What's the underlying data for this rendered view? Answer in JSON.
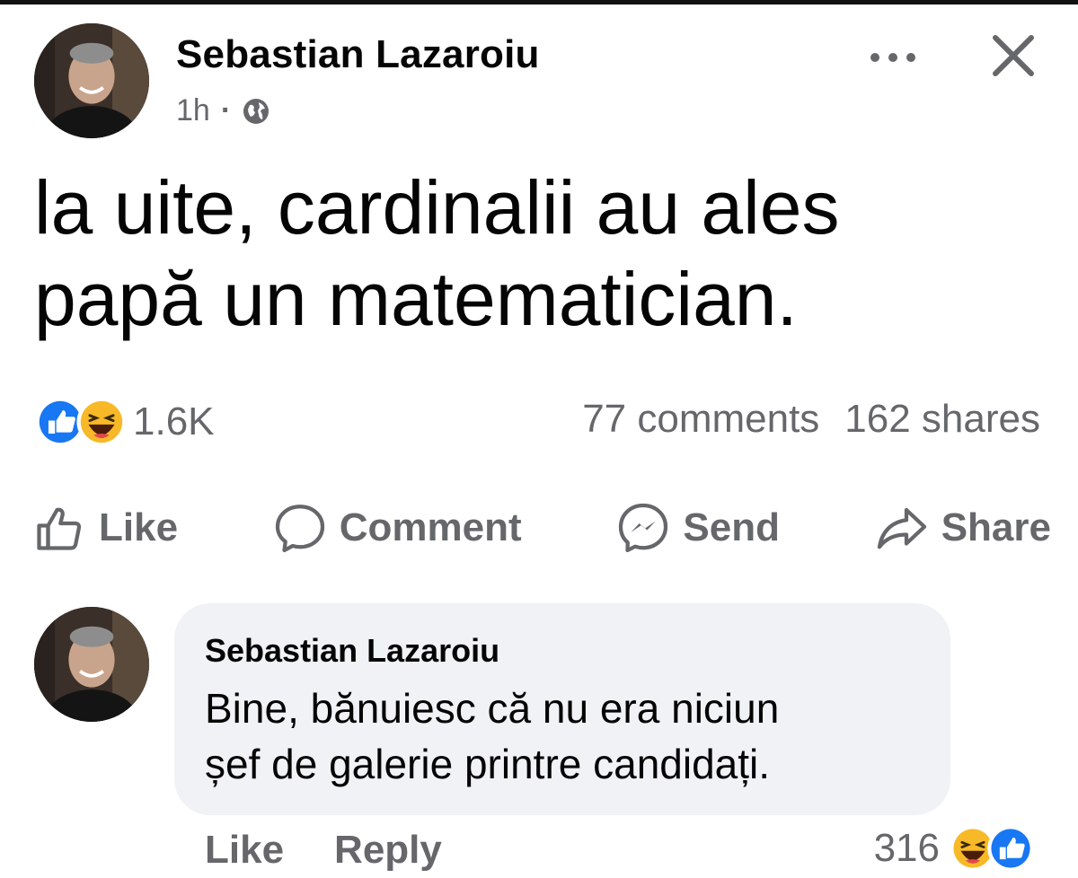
{
  "post": {
    "author": "Sebastian Lazaroiu",
    "time": "1h",
    "separator": "·",
    "privacy_icon": "globe-icon",
    "text_line1": "la uite, cardinalii au ales",
    "text_line2": "papă un matematician.",
    "reactions": {
      "icons": [
        "like-icon",
        "haha-icon"
      ],
      "count": "1.6K"
    },
    "comments": "77 comments",
    "shares": "162 shares",
    "actions": {
      "like": "Like",
      "comment": "Comment",
      "send": "Send",
      "share": "Share"
    }
  },
  "comment": {
    "author": "Sebastian Lazaroiu",
    "text_line1": "Bine, bănuiesc că nu era niciun",
    "text_line2": "șef de galerie printre candidați.",
    "like": "Like",
    "reply": "Reply",
    "reaction_count": "316",
    "reaction_icons": [
      "haha-icon",
      "like-icon"
    ]
  },
  "colors": {
    "text_primary": "#050505",
    "text_secondary": "#65676b",
    "like_blue": "#1877f2",
    "haha_yellow": "#f7b928",
    "bubble_bg": "#f0f2f5"
  }
}
